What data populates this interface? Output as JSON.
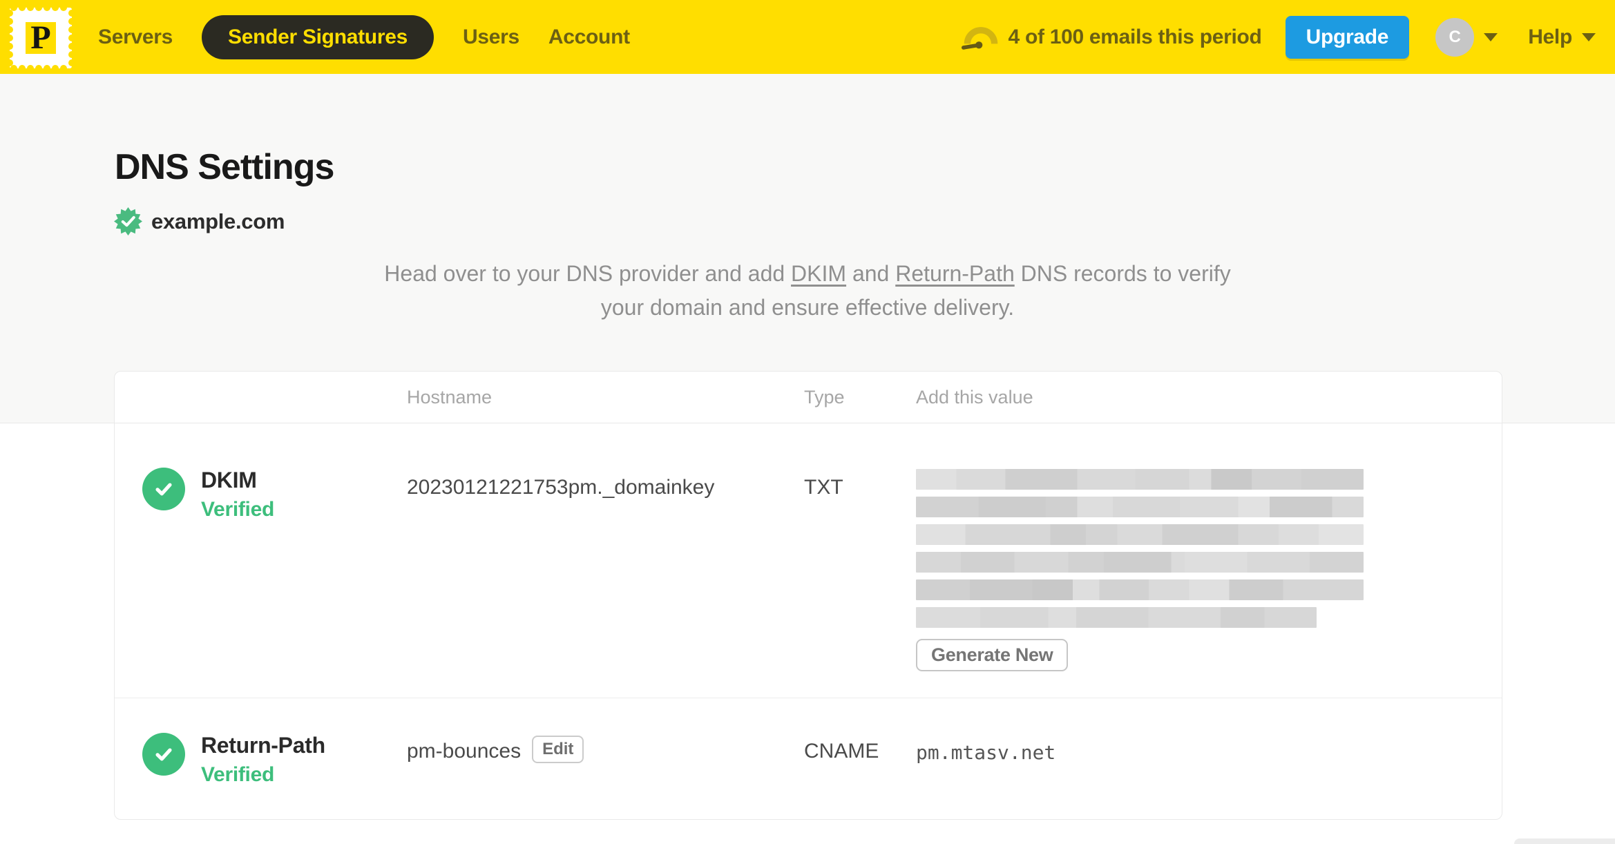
{
  "navbar": {
    "logo_letter": "P",
    "items": [
      {
        "label": "Servers",
        "active": false
      },
      {
        "label": "Sender Signatures",
        "active": true
      },
      {
        "label": "Users",
        "active": false
      },
      {
        "label": "Account",
        "active": false
      }
    ],
    "usage_text": "4 of 100 emails this period",
    "upgrade_label": "Upgrade",
    "avatar_initial": "C",
    "help_label": "Help"
  },
  "page": {
    "title": "DNS Settings",
    "domain": "example.com",
    "intro_part1": "Head over to your DNS provider and add ",
    "intro_link1": "DKIM",
    "intro_part2": " and ",
    "intro_link2": "Return-Path",
    "intro_part3": " DNS records to verify your domain and ensure effective delivery."
  },
  "table": {
    "headers": {
      "hostname": "Hostname",
      "type": "Type",
      "value": "Add this value"
    },
    "rows": [
      {
        "name": "DKIM",
        "status": "Verified",
        "hostname": "20230121221753pm._domainkey",
        "type": "TXT",
        "value_redacted": true,
        "action_label": "Generate New"
      },
      {
        "name": "Return-Path",
        "status": "Verified",
        "hostname": "pm-bounces",
        "hostname_action": "Edit",
        "type": "CNAME",
        "value": "pm.mtasv.net"
      }
    ]
  },
  "colors": {
    "brand_yellow": "#ffde00",
    "nav_text_olive": "#6c6013",
    "active_pill_bg": "#2b2a22",
    "upgrade_blue": "#1d9be1",
    "success_green": "#3dbe7c"
  }
}
